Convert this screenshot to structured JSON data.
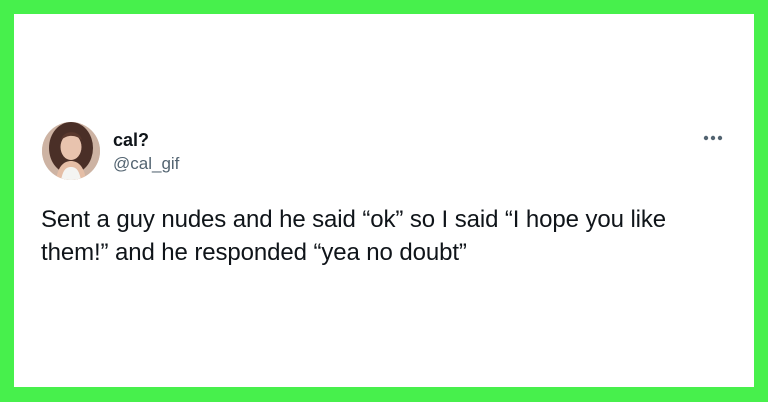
{
  "tweet": {
    "author": {
      "display_name": "cal?",
      "handle": "@cal_gif",
      "avatar_icon": "profile-photo"
    },
    "more_icon": "more-horizontal-icon",
    "text": "Sent a guy nudes and he said “ok” so I said “I hope you like them!” and he responded “yea no doubt”"
  },
  "colors": {
    "frame_border": "#47f04c",
    "card_background": "#ffffff",
    "text_primary": "#0f1419",
    "text_secondary": "#536471"
  }
}
